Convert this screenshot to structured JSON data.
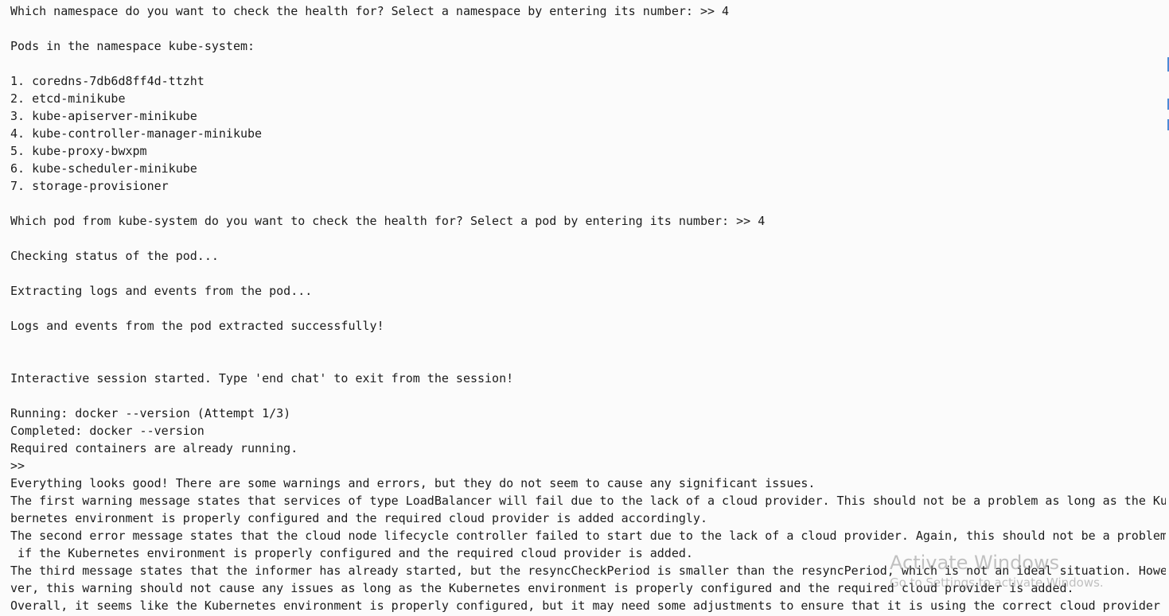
{
  "terminal": {
    "lines": [
      "Which namespace do you want to check the health for? Select a namespace by entering its number: >> 4",
      "",
      "Pods in the namespace kube-system:",
      "",
      "1. coredns-7db6d8ff4d-ttzht",
      "2. etcd-minikube",
      "3. kube-apiserver-minikube",
      "4. kube-controller-manager-minikube",
      "5. kube-proxy-bwxpm",
      "6. kube-scheduler-minikube",
      "7. storage-provisioner",
      "",
      "Which pod from kube-system do you want to check the health for? Select a pod by entering its number: >> 4",
      "",
      "Checking status of the pod...",
      "",
      "Extracting logs and events from the pod...",
      "",
      "Logs and events from the pod extracted successfully!",
      "",
      "",
      "Interactive session started. Type 'end chat' to exit from the session!",
      "",
      "Running: docker --version (Attempt 1/3)",
      "Completed: docker --version",
      "Required containers are already running.",
      ">>",
      "Everything looks good! There are some warnings and errors, but they do not seem to cause any significant issues.",
      "The first warning message states that services of type LoadBalancer will fail due to the lack of a cloud provider. This should not be a problem as long as the Ku",
      "bernetes environment is properly configured and the required cloud provider is added accordingly.",
      "The second error message states that the cloud node lifecycle controller failed to start due to the lack of a cloud provider. Again, this should not be a problem",
      " if the Kubernetes environment is properly configured and the required cloud provider is added.",
      "The third message states that the informer has already started, but the resyncCheckPeriod is smaller than the resyncPeriod, which is not an ideal situation. Howe",
      "ver, this warning should not cause any issues as long as the Kubernetes environment is properly configured and the required cloud provider is added.",
      "Overall, it seems like the Kubernetes environment is properly configured, but it may need some adjustments to ensure that it is using the correct cloud provider"
    ]
  },
  "watermark": {
    "title": "Activate Windows",
    "subtitle": "Go to Settings to activate Windows."
  }
}
